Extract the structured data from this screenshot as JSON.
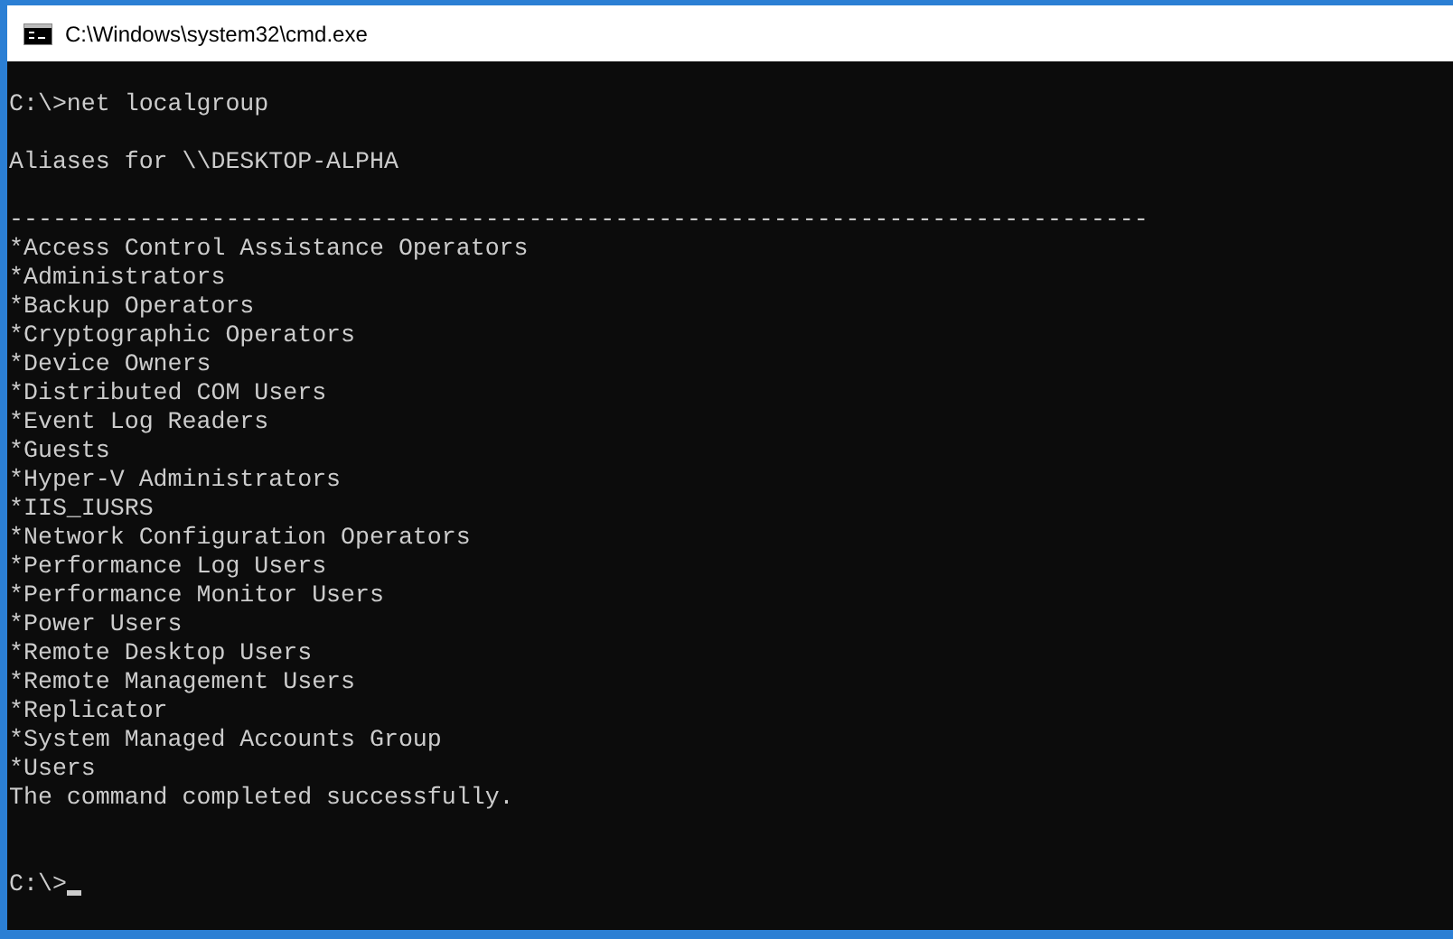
{
  "window": {
    "title": "C:\\Windows\\system32\\cmd.exe"
  },
  "console": {
    "command_line": "C:\\>net localgroup",
    "header": "Aliases for \\\\DESKTOP-ALPHA",
    "separator": "-------------------------------------------------------------------------------",
    "groups": [
      "*Access Control Assistance Operators",
      "*Administrators",
      "*Backup Operators",
      "*Cryptographic Operators",
      "*Device Owners",
      "*Distributed COM Users",
      "*Event Log Readers",
      "*Guests",
      "*Hyper-V Administrators",
      "*IIS_IUSRS",
      "*Network Configuration Operators",
      "*Performance Log Users",
      "*Performance Monitor Users",
      "*Power Users",
      "*Remote Desktop Users",
      "*Remote Management Users",
      "*Replicator",
      "*System Managed Accounts Group",
      "*Users"
    ],
    "result": "The command completed successfully.",
    "prompt": "C:\\>"
  }
}
